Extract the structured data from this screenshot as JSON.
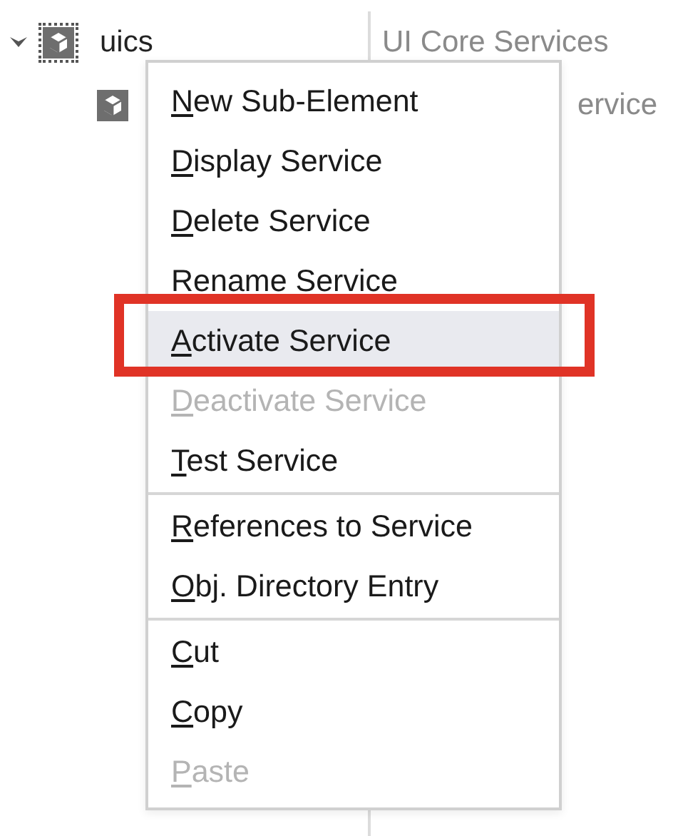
{
  "tree": {
    "rows": [
      {
        "name": "uics",
        "expanded": true,
        "focused": true,
        "description": "UI Core Services",
        "children": [
          {
            "description": "ervice"
          }
        ]
      }
    ]
  },
  "context_menu": {
    "items": [
      {
        "kind": "item",
        "label": "New Sub-Element",
        "disabled": false,
        "selected": false,
        "framed": false
      },
      {
        "kind": "item",
        "label": "Display Service",
        "disabled": false,
        "selected": false,
        "framed": false
      },
      {
        "kind": "item",
        "label": "Delete Service",
        "disabled": false,
        "selected": false,
        "framed": false
      },
      {
        "kind": "item",
        "label": "Rename Service",
        "disabled": false,
        "selected": false,
        "framed": false
      },
      {
        "kind": "item",
        "label": "Activate Service",
        "disabled": false,
        "selected": true,
        "framed": true
      },
      {
        "kind": "item",
        "label": "Deactivate Service",
        "disabled": true,
        "selected": false,
        "framed": false
      },
      {
        "kind": "item",
        "label": "Test Service",
        "disabled": false,
        "selected": false,
        "framed": false
      },
      {
        "kind": "separator"
      },
      {
        "kind": "item",
        "label": "References to Service",
        "disabled": false,
        "selected": false,
        "framed": false
      },
      {
        "kind": "item",
        "label": "Obj. Directory Entry",
        "disabled": false,
        "selected": false,
        "framed": false
      },
      {
        "kind": "separator"
      },
      {
        "kind": "item",
        "label": "Cut",
        "disabled": false,
        "selected": false,
        "framed": false
      },
      {
        "kind": "item",
        "label": "Copy",
        "disabled": false,
        "selected": false,
        "framed": false
      },
      {
        "kind": "item",
        "label": "Paste",
        "disabled": true,
        "selected": false,
        "framed": false
      }
    ]
  }
}
